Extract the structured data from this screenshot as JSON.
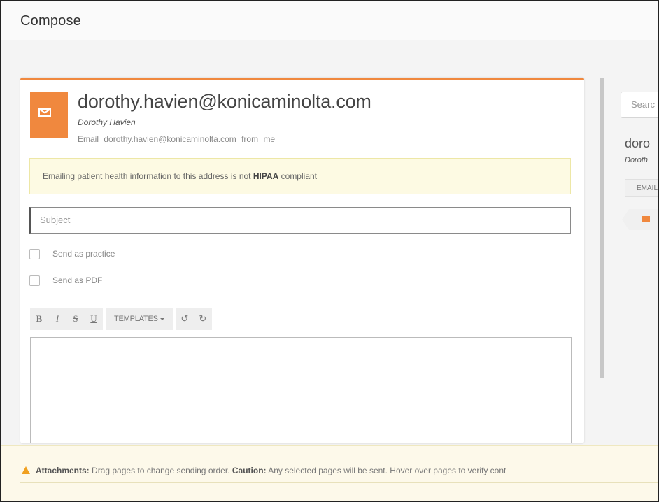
{
  "header": {
    "title": "Compose"
  },
  "recipient": {
    "email": "dorothy.havien@konicaminolta.com",
    "name": "Dorothy Havien",
    "line_prefix": "Email",
    "line_email": "dorothy.havien@konicaminolta.com",
    "line_from": "from",
    "line_me": "me"
  },
  "warning": {
    "text": "Emailing patient health information to this address is not",
    "emph": "HIPAA",
    "suffix": "compliant"
  },
  "subject": {
    "placeholder": "Subject",
    "value": ""
  },
  "options": [
    {
      "label": "Send as practice",
      "checked": false
    },
    {
      "label": "Send as PDF",
      "checked": false
    }
  ],
  "toolbar": {
    "bold": "B",
    "italic": "I",
    "strike": "S",
    "underline": "U",
    "templates": "TEMPLATES",
    "undo": "↺",
    "redo": "↻"
  },
  "right_panel": {
    "search_placeholder": "Searc",
    "contact_name": "doro",
    "contact_sub": "Doroth",
    "chip": "EMAIL",
    "accent": "#f0883e"
  },
  "attachments": {
    "label": "Attachments:",
    "text1": "Drag pages to change sending order.",
    "caution_label": "Caution:",
    "text2": "Any selected pages will be sent. Hover over pages to verify cont"
  },
  "colors": {
    "accent": "#f0883e",
    "warning_bg": "#fdfae3",
    "attachments_bg": "#fdf9ea"
  }
}
